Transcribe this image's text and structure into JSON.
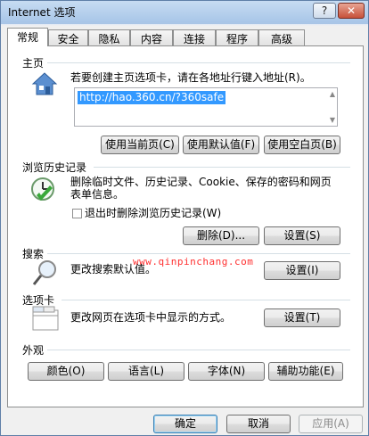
{
  "window": {
    "title": "Internet 选项",
    "help_label": "?",
    "close_label": "✕"
  },
  "tabs": [
    {
      "label": "常规",
      "active": true
    },
    {
      "label": "安全"
    },
    {
      "label": "隐私"
    },
    {
      "label": "内容"
    },
    {
      "label": "连接"
    },
    {
      "label": "程序"
    },
    {
      "label": "高级"
    }
  ],
  "homepage": {
    "section_title": "主页",
    "description": "若要创建主页选项卡，请在各地址行键入地址(R)。",
    "url": "http://hao.360.cn/?360safe",
    "buttons": {
      "use_current": "使用当前页(C)",
      "use_default": "使用默认值(F)",
      "use_blank": "使用空白页(B)"
    }
  },
  "history": {
    "section_title": "浏览历史记录",
    "description": "删除临时文件、历史记录、Cookie、保存的密码和网页表单信息。",
    "delete_on_exit": "退出时删除浏览历史记录(W)",
    "delete_on_exit_checked": false,
    "delete_button": "删除(D)...",
    "settings_button": "设置(S)"
  },
  "search": {
    "section_title": "搜索",
    "description": "更改搜索默认值。",
    "settings_button": "设置(I)"
  },
  "tabsection": {
    "section_title": "选项卡",
    "description": "更改网页在选项卡中显示的方式。",
    "settings_button": "设置(T)"
  },
  "appearance": {
    "section_title": "外观",
    "colors_button": "颜色(O)",
    "languages_button": "语言(L)",
    "fonts_button": "字体(N)",
    "accessibility_button": "辅助功能(E)"
  },
  "footer": {
    "ok_button": "确定",
    "cancel_button": "取消",
    "apply_button": "应用(A)"
  },
  "watermark": "www.qinpinchang.com",
  "colors": {
    "accent": "#3399ff",
    "watermark": "#ff3030"
  }
}
